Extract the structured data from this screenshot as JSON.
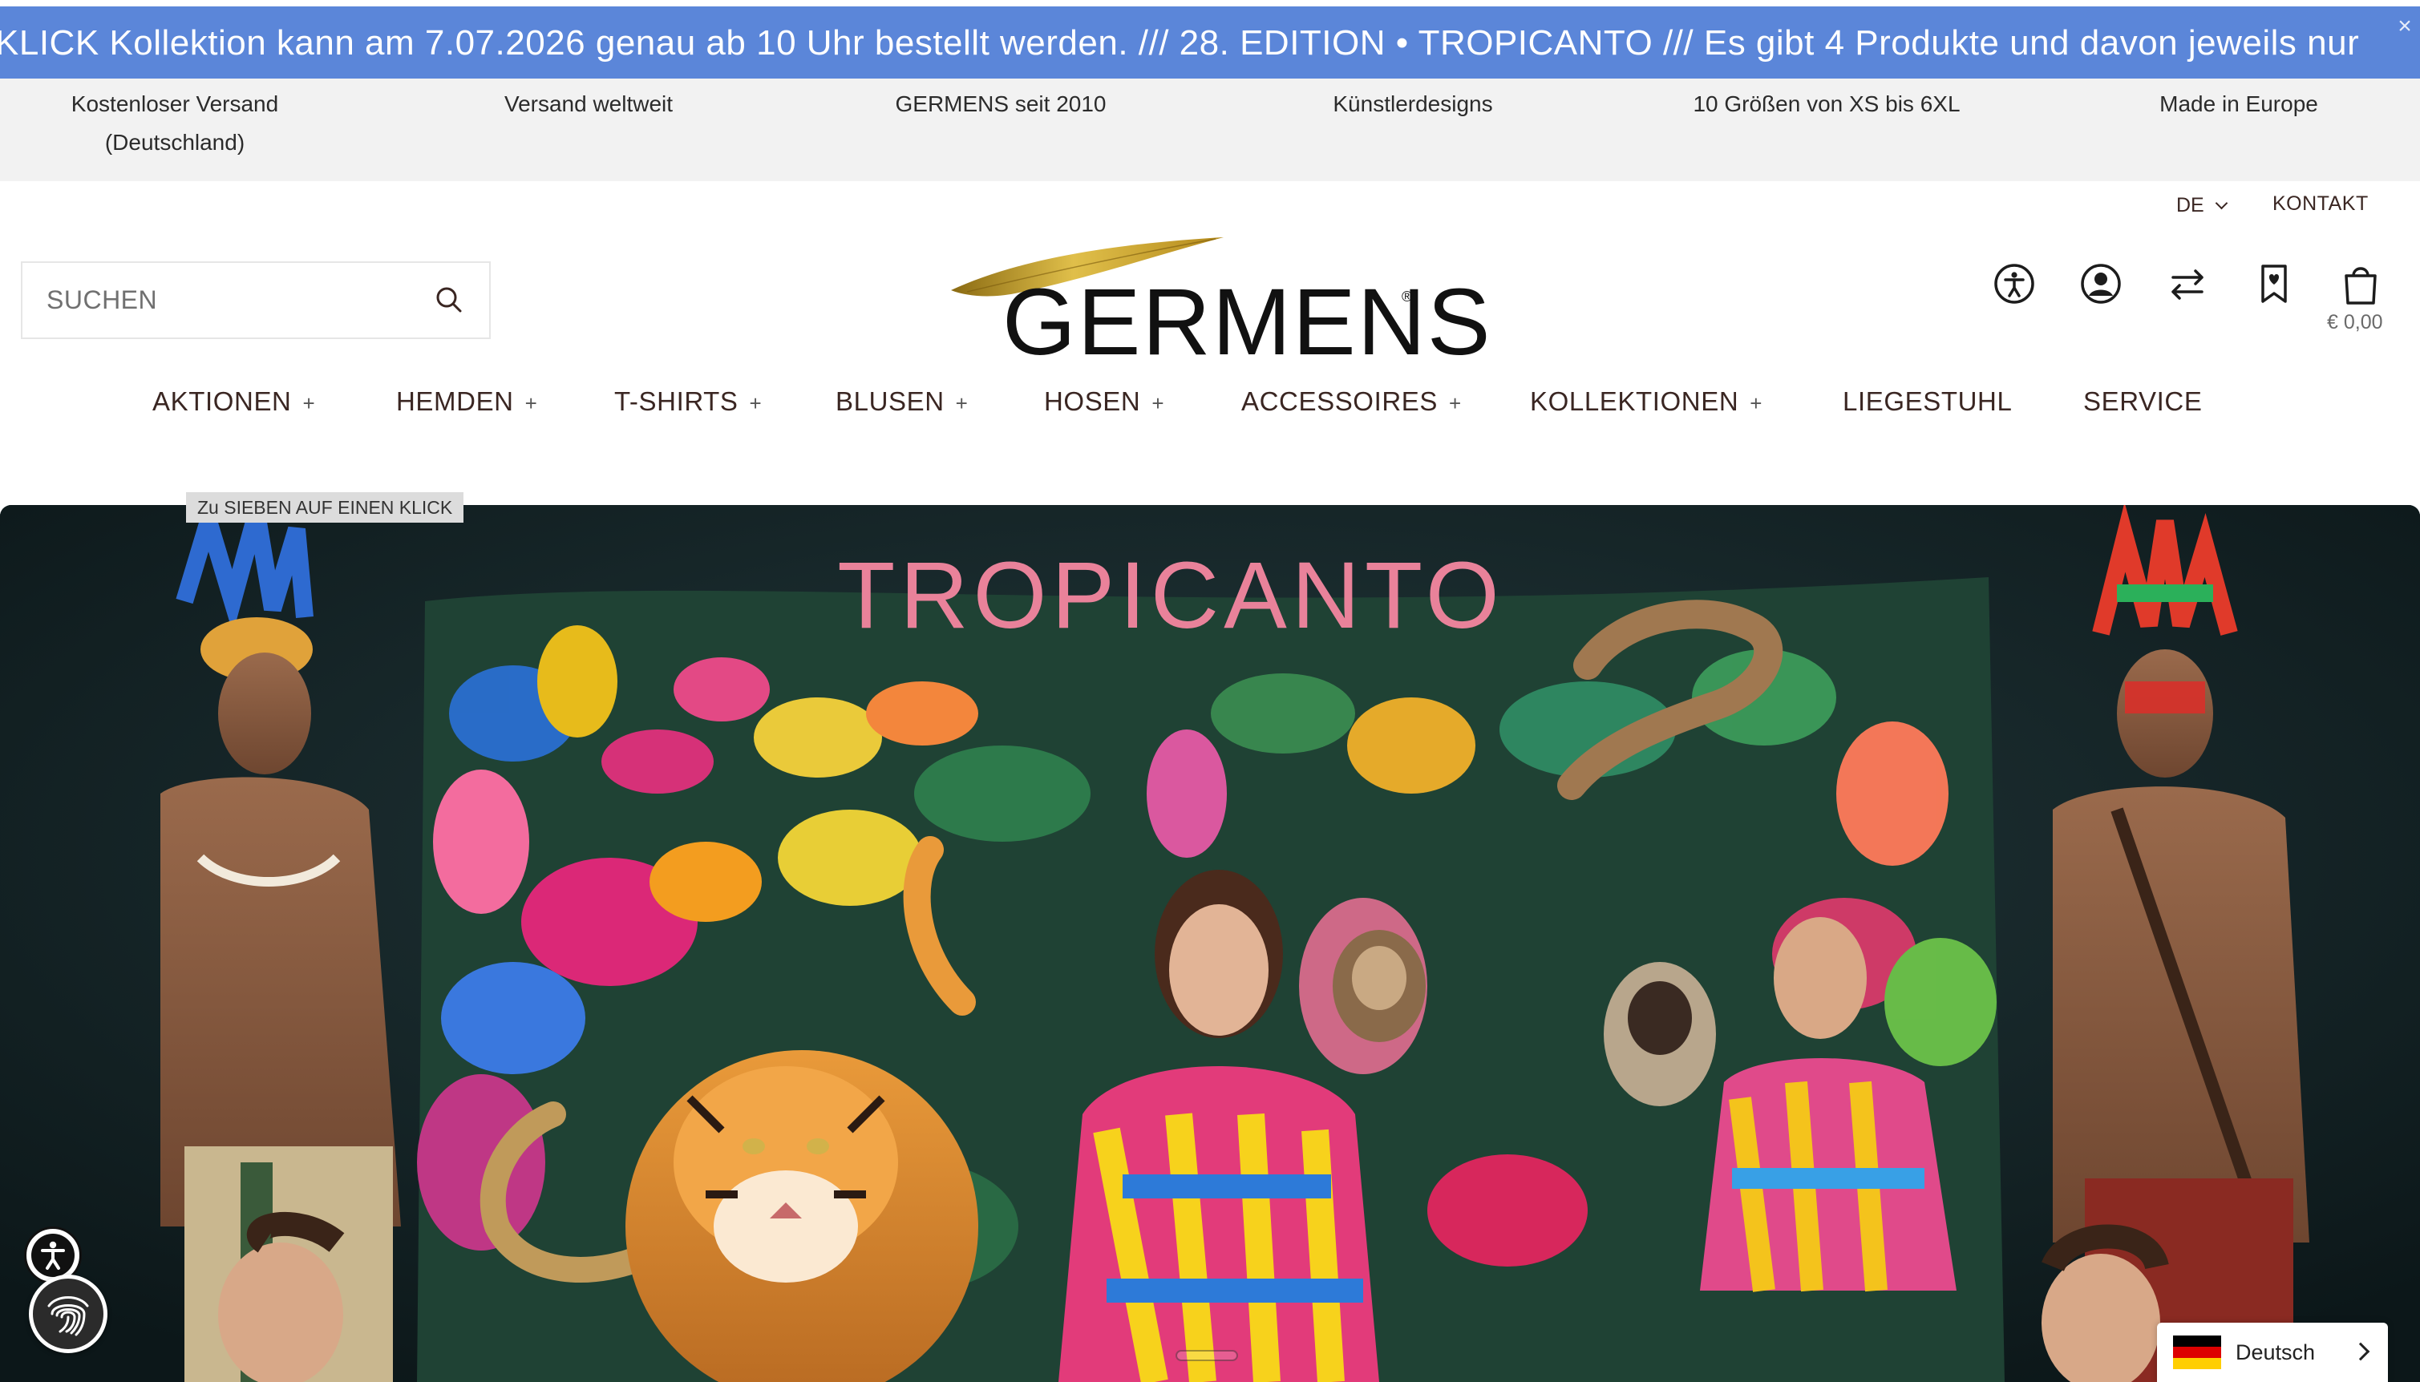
{
  "announcement": {
    "text": "KLICK Kollektion kann am 7.07.2026 genau ab 10 Uhr bestellt werden. /// 28. EDITION • TROPICANTO /// Es gibt 4 Produkte und davon jeweils nur",
    "close_icon": "close-icon"
  },
  "usp": [
    {
      "line1": "Kostenloser Versand",
      "line2": "(Deutschland)"
    },
    {
      "line1": "Versand weltweit"
    },
    {
      "line1": "GERMENS seit 2010"
    },
    {
      "line1": "Künstlerdesigns"
    },
    {
      "line1": "10 Größen von XS bis 6XL"
    },
    {
      "line1": "Made in Europe"
    }
  ],
  "header": {
    "language": "DE",
    "contact": "KONTAKT",
    "search_placeholder": "SUCHEN",
    "logo_text": "GERMENS",
    "logo_mark": "®",
    "cart_total": "€ 0,00",
    "icons": [
      "accessibility-icon",
      "account-icon",
      "compare-icon",
      "wishlist-icon",
      "cart-icon"
    ],
    "colors": {
      "logo_leaf": "#c9a32e",
      "text": "#3a2622"
    }
  },
  "nav": [
    {
      "label": "AKTIONEN",
      "plus": "+"
    },
    {
      "label": "HEMDEN",
      "plus": "+"
    },
    {
      "label": "T-SHIRTS",
      "plus": "+"
    },
    {
      "label": "BLUSEN",
      "plus": "+"
    },
    {
      "label": "HOSEN",
      "plus": "+"
    },
    {
      "label": "ACCESSOIRES",
      "plus": "+"
    },
    {
      "label": "KOLLEKTIONEN",
      "plus": "+"
    },
    {
      "label": "LIEGESTUHL"
    },
    {
      "label": "SERVICE"
    }
  ],
  "hero": {
    "title": "TROPICANTO",
    "tooltip": "Zu SIEBEN AUF EINEN KLICK",
    "title_color": "#e9829a"
  },
  "widgets": {
    "language_label": "Deutsch",
    "flag": "germany-flag-icon"
  }
}
